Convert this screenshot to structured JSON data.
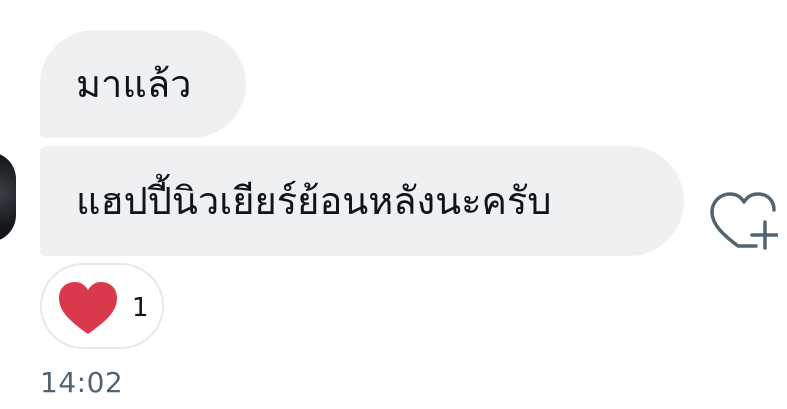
{
  "messages": [
    {
      "text": "มาแล้ว"
    },
    {
      "text": "แฮปปี้นิวเยียร์ย้อนหลังนะครับ"
    }
  ],
  "reaction": {
    "icon": "heart-icon",
    "count": "1",
    "color": "#d83a4c"
  },
  "timestamp": "14:02",
  "colors": {
    "bubble": "#eef0f2",
    "text": "#0f1419",
    "muted": "#536471"
  }
}
